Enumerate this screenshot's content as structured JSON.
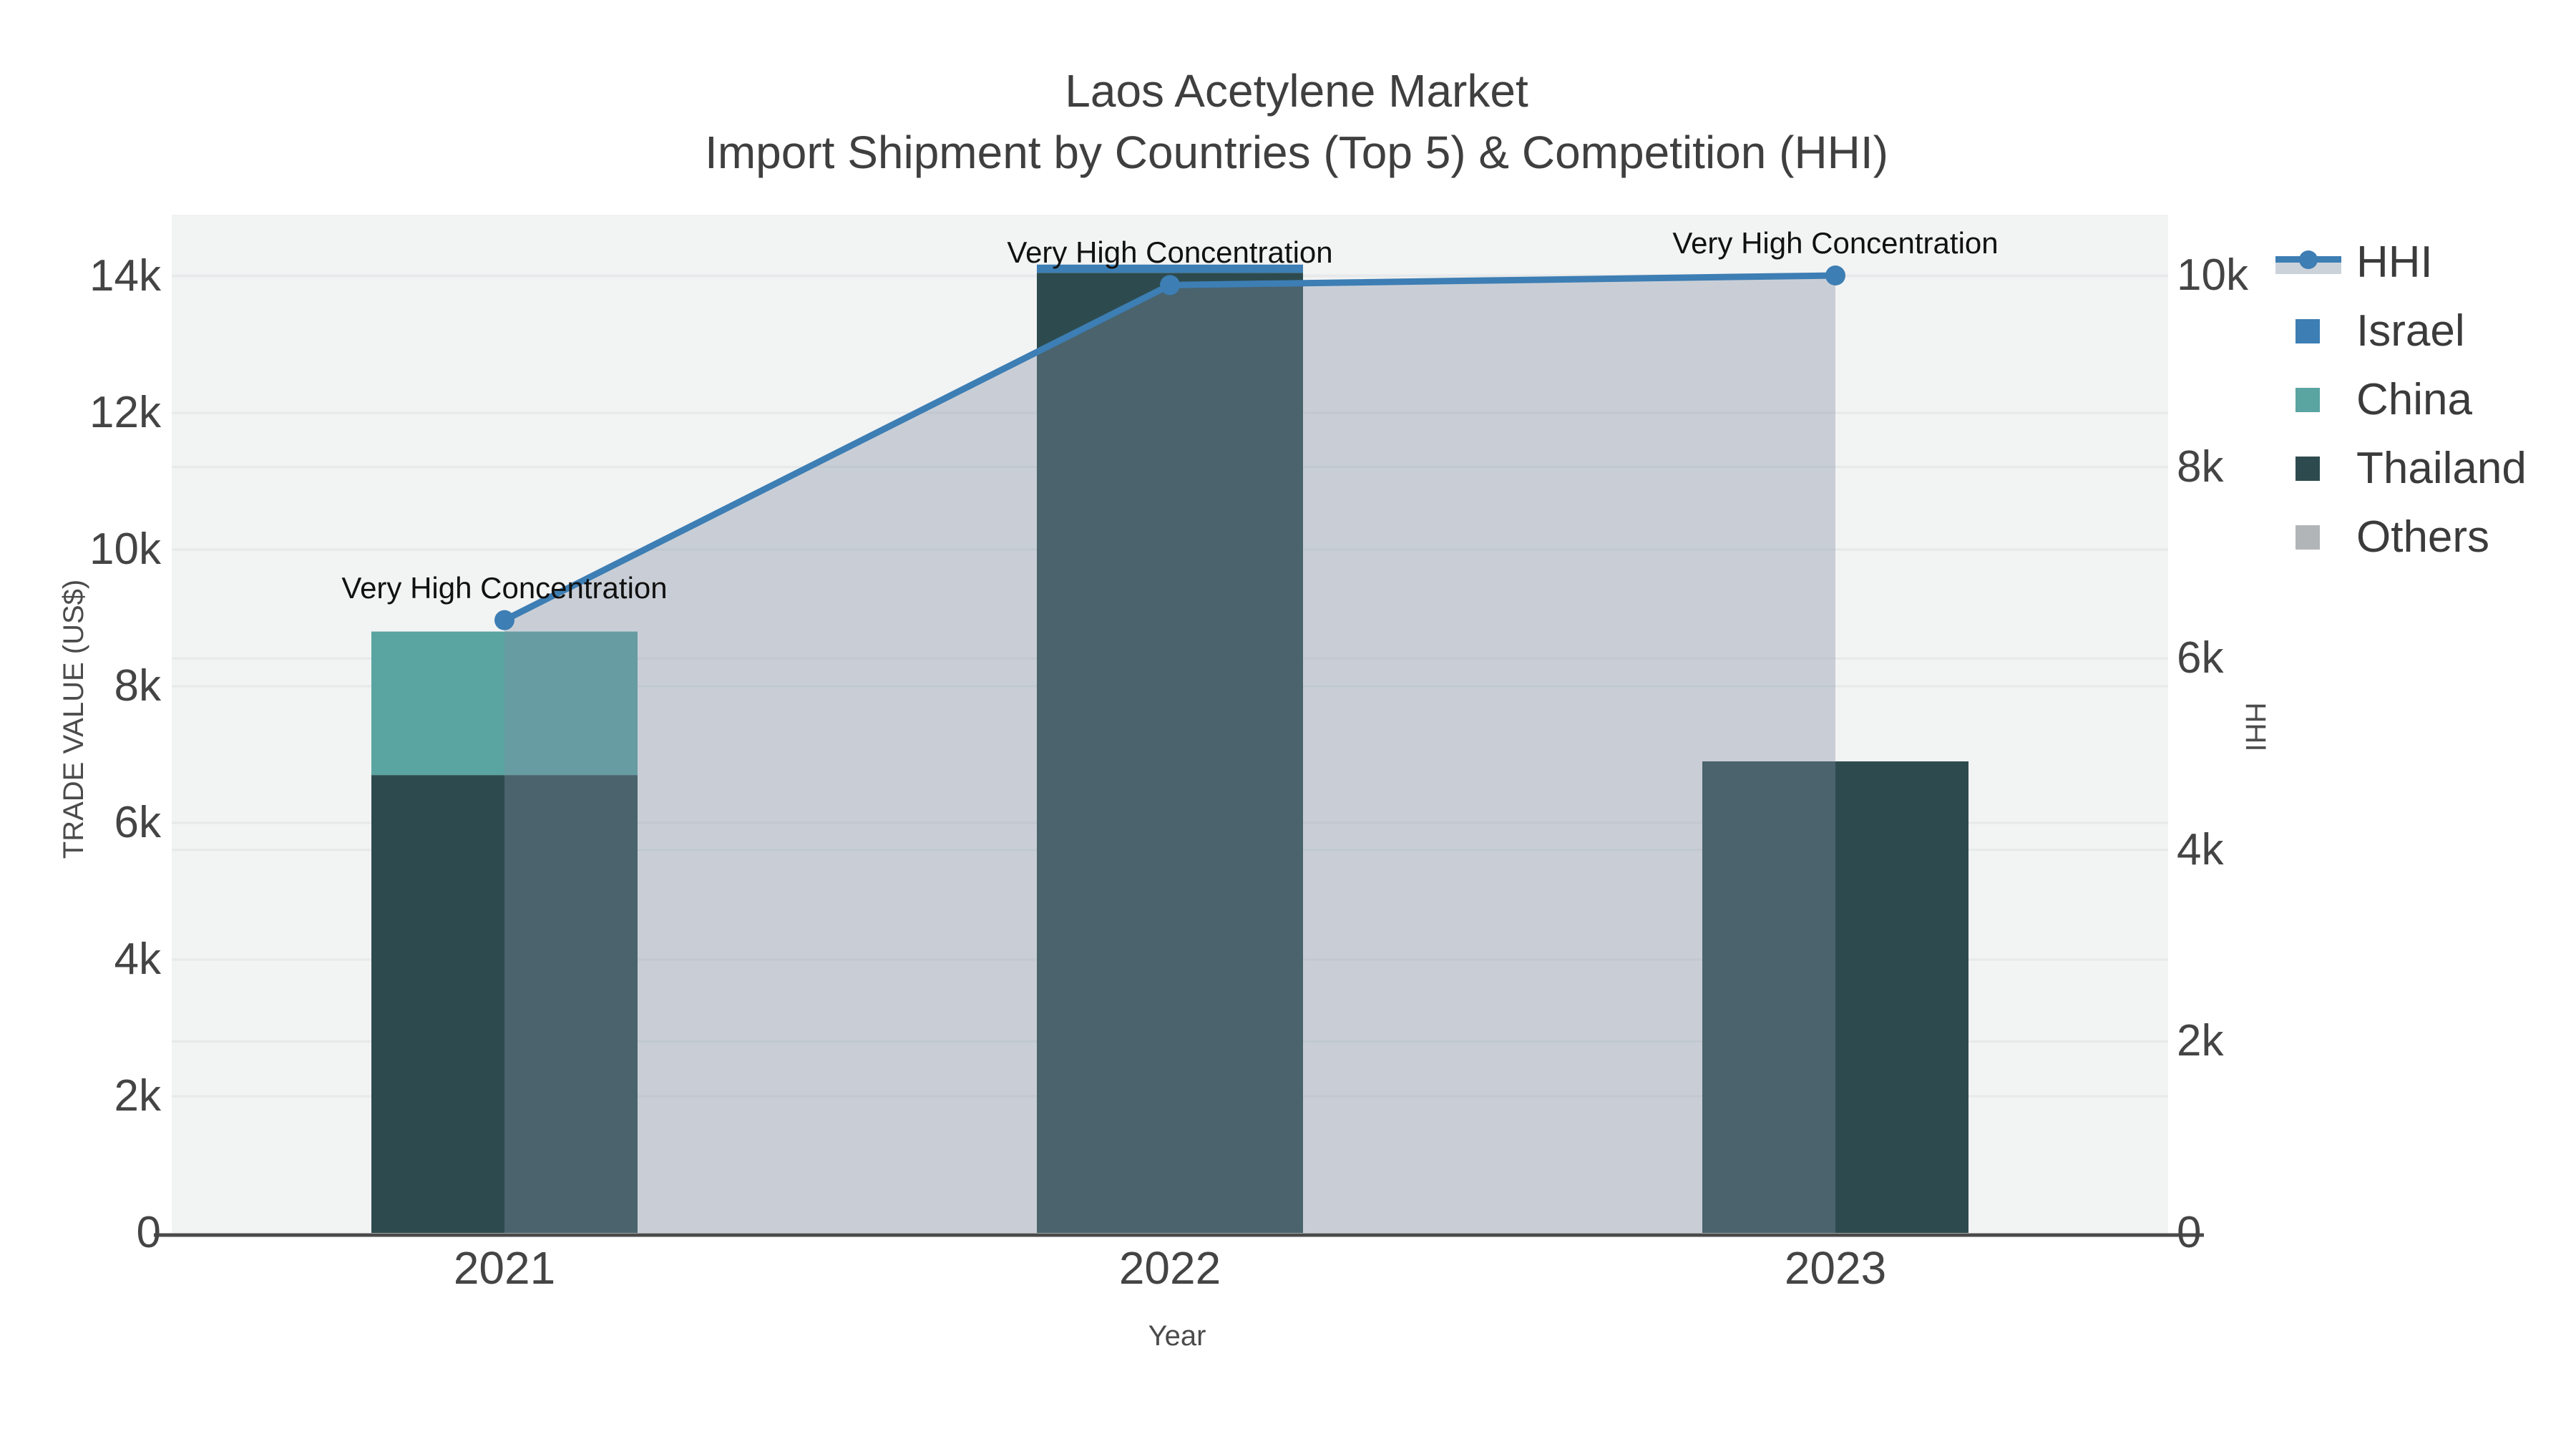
{
  "title": {
    "line1": "Laos Acetylene Market",
    "line2": "Import Shipment by Countries (Top 5) & Competition (HHI)"
  },
  "axes": {
    "x": {
      "title": "Year",
      "categories": [
        "2021",
        "2022",
        "2023"
      ]
    },
    "y_left": {
      "title": "TRADE VALUE (US$)",
      "tick_labels": [
        "0",
        "2k",
        "4k",
        "6k",
        "8k",
        "10k",
        "12k",
        "14k"
      ],
      "tick_values": [
        0,
        2000,
        4000,
        6000,
        8000,
        10000,
        12000,
        14000
      ],
      "range": [
        0,
        14950
      ]
    },
    "y_right": {
      "title": "HHI",
      "tick_labels": [
        "0",
        "2k",
        "4k",
        "6k",
        "8k",
        "10k"
      ],
      "tick_values": [
        0,
        2000,
        4000,
        6000,
        8000,
        10000
      ],
      "range": [
        0,
        10680
      ]
    }
  },
  "legend": {
    "items": [
      {
        "label": "HHI",
        "swatch": "line-area",
        "color": "#3d7eb4",
        "band_color": "#ccd2da"
      },
      {
        "label": "Israel",
        "swatch": "square",
        "color": "#3d7eb4"
      },
      {
        "label": "China",
        "swatch": "square",
        "color": "#5aa4a1"
      },
      {
        "label": "Thailand",
        "swatch": "square",
        "color": "#2d4b4f"
      },
      {
        "label": "Others",
        "swatch": "square",
        "color": "#b1b5b8"
      }
    ]
  },
  "annotations": [
    {
      "text": "Very High Concentration",
      "category": "2021"
    },
    {
      "text": "Very High Concentration",
      "category": "2022"
    },
    {
      "text": "Very High Concentration",
      "category": "2023"
    }
  ],
  "colors": {
    "plot_bg": "#f2f3f3",
    "grid": "#e7e9ea",
    "axis_line": "#4a4a4a",
    "tick_text": "#444444",
    "annotation_text": "#111111",
    "hhi_line": "#3d7eb4",
    "hhi_fill": "rgba(127,141,163,0.36)"
  },
  "chart_data": {
    "type": "bar+line",
    "categories": [
      "2021",
      "2022",
      "2023"
    ],
    "bar_axis": "left",
    "bar_series": [
      {
        "name": "Israel",
        "color": "#3d7eb4",
        "values": [
          0,
          120,
          0
        ]
      },
      {
        "name": "China",
        "color": "#5aa4a1",
        "values": [
          2100,
          0,
          0
        ]
      },
      {
        "name": "Thailand",
        "color": "#2d4b4f",
        "values": [
          6700,
          14050,
          6900
        ]
      },
      {
        "name": "Others",
        "color": "#b1b5b8",
        "values": [
          0,
          0,
          0
        ]
      }
    ],
    "stack_order_bottom_to_top": [
      "Thailand",
      "China",
      "Israel",
      "Others"
    ],
    "line_series": {
      "name": "HHI",
      "axis": "right",
      "color": "#3d7eb4",
      "fill_color": "rgba(127,141,163,0.36)",
      "values": [
        6400,
        9900,
        10000
      ]
    },
    "title": "Laos Acetylene Market — Import Shipment by Countries (Top 5) & Competition (HHI)",
    "xlabel": "Year",
    "ylabel_left": "TRADE VALUE (US$)",
    "ylabel_right": "HHI",
    "ylim_left": [
      0,
      14950
    ],
    "ylim_right": [
      0,
      10680
    ],
    "grid": true,
    "legend_position": "right"
  }
}
